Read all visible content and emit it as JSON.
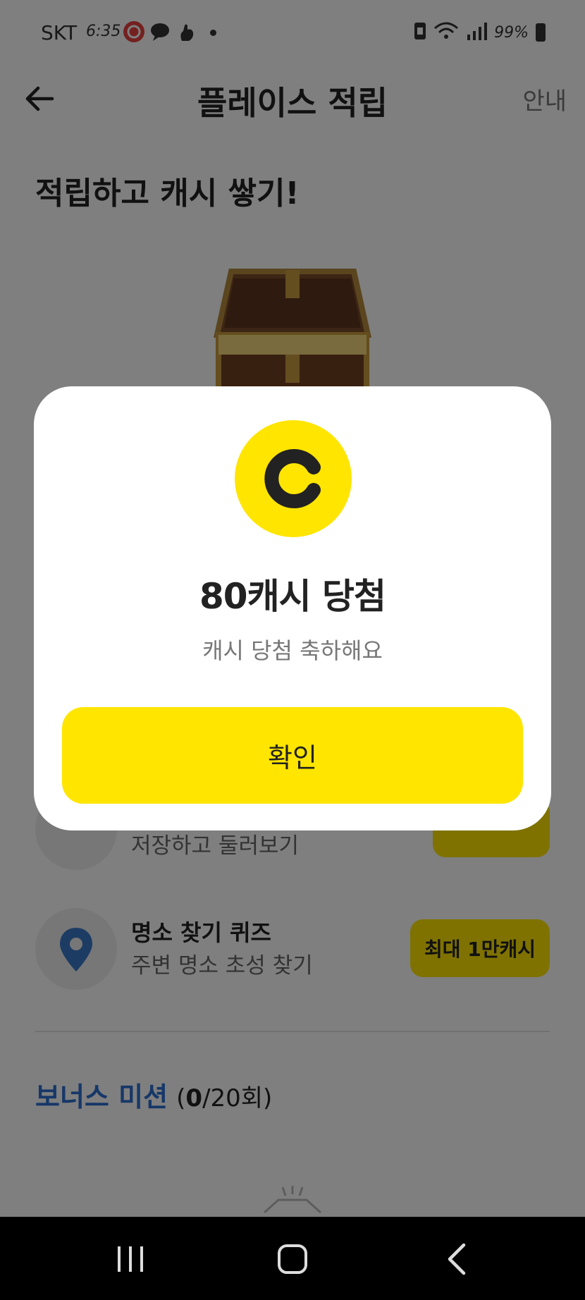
{
  "status_bar": {
    "carrier": "SKT",
    "time": "6:35",
    "battery": "99%",
    "icons": [
      "notification-app-icon",
      "chat-bubble-icon",
      "hand-icon",
      "wifi-icon",
      "signal-icon",
      "battery-icon"
    ]
  },
  "header": {
    "title": "플레이스 적립",
    "guide_label": "안내",
    "back_icon": "arrow-left-icon"
  },
  "main": {
    "headline": "적립하고 캐시 쌓기!",
    "missions": [
      {
        "title": "",
        "subtitle": "저장하고 둘러보기",
        "badge": ""
      },
      {
        "title": "명소 찾기 퀴즈",
        "subtitle": "주변 명소 초성 찾기",
        "badge": "최대 1만캐시",
        "icon": "map-pin-icon"
      }
    ],
    "bonus": {
      "title": "보너스 미션",
      "count_open": "(",
      "count_done": "0",
      "count_total": "/20회)"
    }
  },
  "modal": {
    "coin_letter": "C",
    "title": "80캐시 당첨",
    "subtitle": "캐시 당첨 축하해요",
    "confirm_label": "확인"
  },
  "colors": {
    "accent_yellow": "#ffe500",
    "bonus_blue": "#2c6fd1",
    "pin_blue": "#3b78c9"
  }
}
